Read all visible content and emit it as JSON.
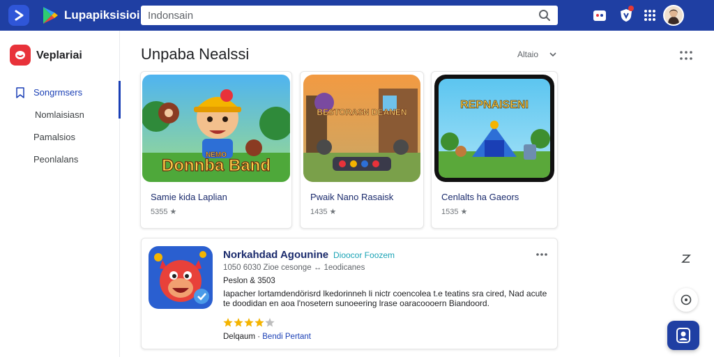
{
  "header": {
    "app_title": "Lupapiksisioi",
    "search_placeholder": "Indonsain",
    "notification_count": "1",
    "icons": [
      "back-arrow-icon",
      "play-store-icon",
      "search-icon",
      "shopping-bag-icon",
      "shield-icon",
      "apps-grid-icon",
      "avatar"
    ]
  },
  "sidebar": {
    "brand": "Veplariai",
    "items": [
      {
        "label": "Songrmsers",
        "active": true,
        "icon": "bookmark-icon"
      },
      {
        "label": "Nomlaisiasn",
        "active": false
      },
      {
        "label": "Pamalsios",
        "active": false
      },
      {
        "label": "Peonlalans",
        "active": false
      }
    ]
  },
  "main": {
    "title": "Unpaba Nealssi",
    "sort_label": "Altaio",
    "cards": [
      {
        "title": "Samie kida Laplian",
        "meta": "5355 ★",
        "art_text": "Donnba Band",
        "art_text_small": "NEMO"
      },
      {
        "title": "Pwaik Nano Rasaisk",
        "meta": "1435 ★",
        "art_text": "BESTORASN DEANEN"
      },
      {
        "title": "Cenlalts ha Gaeors",
        "meta": "1535 ★",
        "art_text": "REPNAISENI"
      }
    ],
    "featured": {
      "title": "Norkahdad Agounine",
      "separator": "·",
      "developer": "Dioocor Foozem",
      "subtitle": "1050 6030 Zioe cesonge ↔ 1eodicanes",
      "price": "Peslon & 3503",
      "description": "Iapacher lortamdendörisrd lkedorinneh li nictr coencolea t.e teatins sra cired, Nad acute te doodidan en aoa l'nosetern sunoeering lrase oaracoooern Biandoord.",
      "rating": 4.5,
      "footer_label": "Delqaum",
      "footer_link": "Bendi Pertant"
    }
  },
  "colors": {
    "topbar": "#1f3fa3",
    "accent": "#1a3fb5",
    "brand_logo": "#e8323a",
    "developer_link": "#1aa3b5",
    "star": "#f4b400"
  }
}
